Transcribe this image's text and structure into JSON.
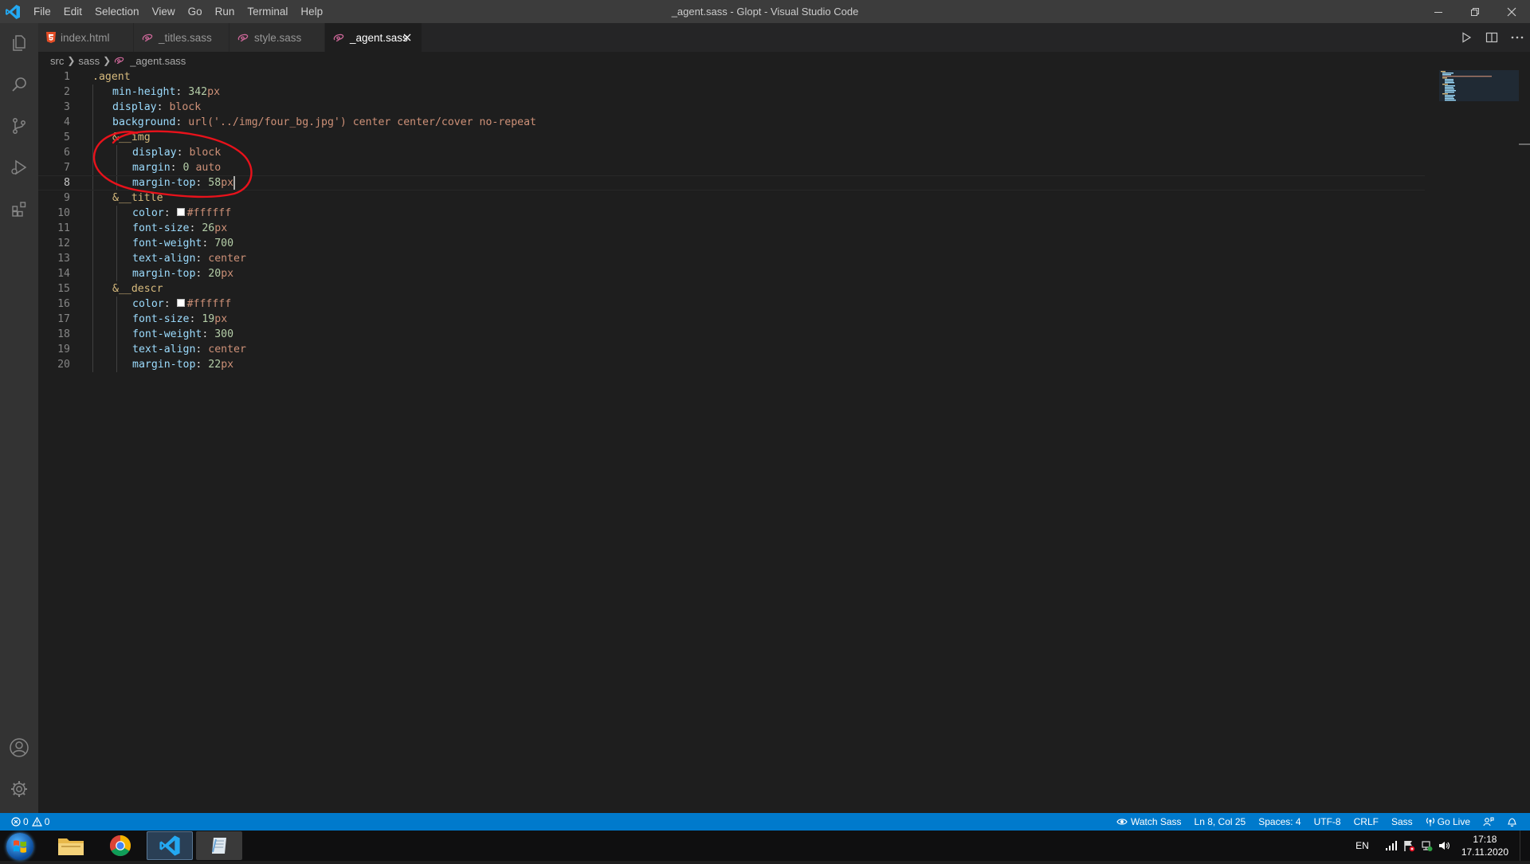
{
  "window": {
    "title": "_agent.sass - Glopt - Visual Studio Code",
    "menu": [
      "File",
      "Edit",
      "Selection",
      "View",
      "Go",
      "Run",
      "Terminal",
      "Help"
    ]
  },
  "tabs": [
    {
      "label": "index.html",
      "icon": "html5-icon",
      "active": false
    },
    {
      "label": "_titles.sass",
      "icon": "sass-icon",
      "active": false
    },
    {
      "label": "style.sass",
      "icon": "sass-icon",
      "active": false
    },
    {
      "label": "_agent.sass",
      "icon": "sass-icon",
      "active": true
    }
  ],
  "breadcrumb": [
    "src",
    "sass",
    "_agent.sass"
  ],
  "editor": {
    "line_numbers": [
      "1",
      "2",
      "3",
      "4",
      "5",
      "6",
      "7",
      "8",
      "9",
      "10",
      "11",
      "12",
      "13",
      "14",
      "15",
      "16",
      "17",
      "18",
      "19",
      "20"
    ],
    "lines": [
      {
        "indent": 0,
        "sel": ".agent"
      },
      {
        "indent": 1,
        "prop": "min-height",
        "num": "342",
        "unit": "px"
      },
      {
        "indent": 1,
        "prop": "display",
        "val": "block"
      },
      {
        "indent": 1,
        "prop": "background",
        "val": "url('../img/four_bg.jpg') center center/cover no-repeat"
      },
      {
        "indent": 1,
        "sel": "&__img"
      },
      {
        "indent": 2,
        "prop": "display",
        "val": "block"
      },
      {
        "indent": 2,
        "prop": "margin",
        "num": "0",
        "val": "auto"
      },
      {
        "indent": 2,
        "prop": "margin-top",
        "num": "58",
        "unit": "px"
      },
      {
        "indent": 1,
        "sel": "&__title"
      },
      {
        "indent": 2,
        "prop": "color",
        "color": "#ffffff"
      },
      {
        "indent": 2,
        "prop": "font-size",
        "num": "26",
        "unit": "px"
      },
      {
        "indent": 2,
        "prop": "font-weight",
        "num": "700"
      },
      {
        "indent": 2,
        "prop": "text-align",
        "val": "center"
      },
      {
        "indent": 2,
        "prop": "margin-top",
        "num": "20",
        "unit": "px"
      },
      {
        "indent": 1,
        "sel": "&__descr"
      },
      {
        "indent": 2,
        "prop": "color",
        "color": "#ffffff"
      },
      {
        "indent": 2,
        "prop": "font-size",
        "num": "19",
        "unit": "px"
      },
      {
        "indent": 2,
        "prop": "font-weight",
        "num": "300"
      },
      {
        "indent": 2,
        "prop": "text-align",
        "val": "center"
      },
      {
        "indent": 2,
        "prop": "margin-top",
        "num": "22",
        "unit": "px"
      }
    ],
    "current_line": 8,
    "annotation_color": "#e8121b"
  },
  "statusbar": {
    "errors": "0",
    "warnings": "0",
    "watch_sass": "Watch Sass",
    "position": "Ln 8, Col 25",
    "spaces": "Spaces: 4",
    "encoding": "UTF-8",
    "eol": "CRLF",
    "language": "Sass",
    "go_live": "Go Live"
  },
  "taskbar": {
    "apps": [
      "file-explorer-icon",
      "chrome-icon",
      "vscode-icon",
      "notepad-icon"
    ],
    "language": "EN",
    "time": "17:18",
    "date": "17.11.2020"
  },
  "colors": {
    "accent": "#007acc",
    "editor_bg": "#1e1e1e",
    "activity_bar": "#333333",
    "selector": "#d7ba7d",
    "property": "#9cdcfe",
    "value": "#ce9178",
    "number": "#b5cea8"
  }
}
